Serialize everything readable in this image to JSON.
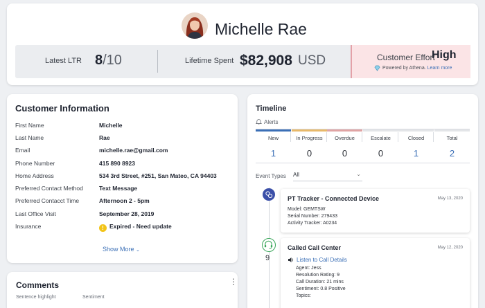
{
  "customer": {
    "name": "Michelle Rae",
    "ltr_label": "Latest LTR",
    "ltr_value": "8",
    "ltr_suffix": "/10",
    "spent_label": "Lifetime Spent",
    "spent_value": "$82,908",
    "spent_unit": "USD",
    "effort_label": "Customer Effort",
    "effort_value": "High",
    "powered_by": "Powered by Athena.",
    "learn_more": "Learn more"
  },
  "info": {
    "title": "Customer Information",
    "rows": [
      {
        "label": "First Name",
        "value": "Michelle"
      },
      {
        "label": "Last Name",
        "value": "Rae"
      },
      {
        "label": "Email",
        "value": "michelle.rae@gmail.com"
      },
      {
        "label": "Phone Number",
        "value": "415 890 8923"
      },
      {
        "label": "Home Address",
        "value": "534 3rd Street, #251, San Mateo, CA 94403"
      },
      {
        "label": "Preferred Contact Method",
        "value": "Text Message"
      },
      {
        "label": "Preferred Contacct Time",
        "value": "Afternoon 2 - 5pm"
      },
      {
        "label": "Last Office Visit",
        "value": "September 28, 2019"
      },
      {
        "label": "Insurance",
        "value": "Expired - Need update"
      }
    ],
    "show_more": "Show More"
  },
  "comments": {
    "title": "Comments",
    "col1": "Sentence highlight",
    "col2": "Sentiment"
  },
  "timeline": {
    "title": "Timeline",
    "alerts_label": "Alerts",
    "alerts": [
      {
        "label": "New",
        "value": "1",
        "color": "#3b6fb6"
      },
      {
        "label": "In Progress",
        "value": "0",
        "color": "#e8b96a"
      },
      {
        "label": "Overdue",
        "value": "0",
        "color": "#e0a4a4"
      },
      {
        "label": "Escalate",
        "value": "0",
        "color": "#e3e5e8"
      },
      {
        "label": "Closed",
        "value": "1",
        "color": "#e3e5e8"
      },
      {
        "label": "Total",
        "value": "2",
        "color": "#e3e5e8"
      }
    ],
    "event_types_label": "Event Types",
    "event_types_value": "All",
    "events": [
      {
        "title": "PT Tracker - Connected Device",
        "date": "May 13, 2020",
        "lines": [
          "Model: GEMTSW",
          "Serial Number: 279433",
          "Activity Tracker: A0234"
        ]
      },
      {
        "title": "Called Call Center",
        "date": "May 12, 2020",
        "link": "Listen to Call Details",
        "lines": [
          "Agent: Jess",
          "Resolution Rating: 9",
          "Call Duration: 21 mins",
          "Sentiment: 0.8 Positive",
          "Topics:"
        ]
      }
    ],
    "event2_count": "9"
  }
}
